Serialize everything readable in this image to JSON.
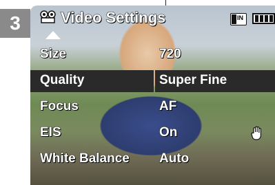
{
  "step_number": "3",
  "header": {
    "title": "Video Settings",
    "title_icon": "camcorder-menu-icon",
    "memory_label": "IN",
    "memory_icon": "internal-memory-icon",
    "battery_icon": "battery-full-icon"
  },
  "menu": {
    "items": [
      {
        "label": "Size",
        "value": "720"
      },
      {
        "label": "Quality",
        "value": "Super Fine",
        "selected": true
      },
      {
        "label": "Focus",
        "value": "AF"
      },
      {
        "label": "EIS",
        "value": "On"
      },
      {
        "label": "White Balance",
        "value": "Auto"
      }
    ]
  },
  "indicators": {
    "eis_icon": "hand-shake-icon",
    "up_arrow_icon": "up-arrow-icon"
  },
  "colors": {
    "badge": "#8a8a8a",
    "selection": "#2a2a2a",
    "text": "#ffffff"
  }
}
